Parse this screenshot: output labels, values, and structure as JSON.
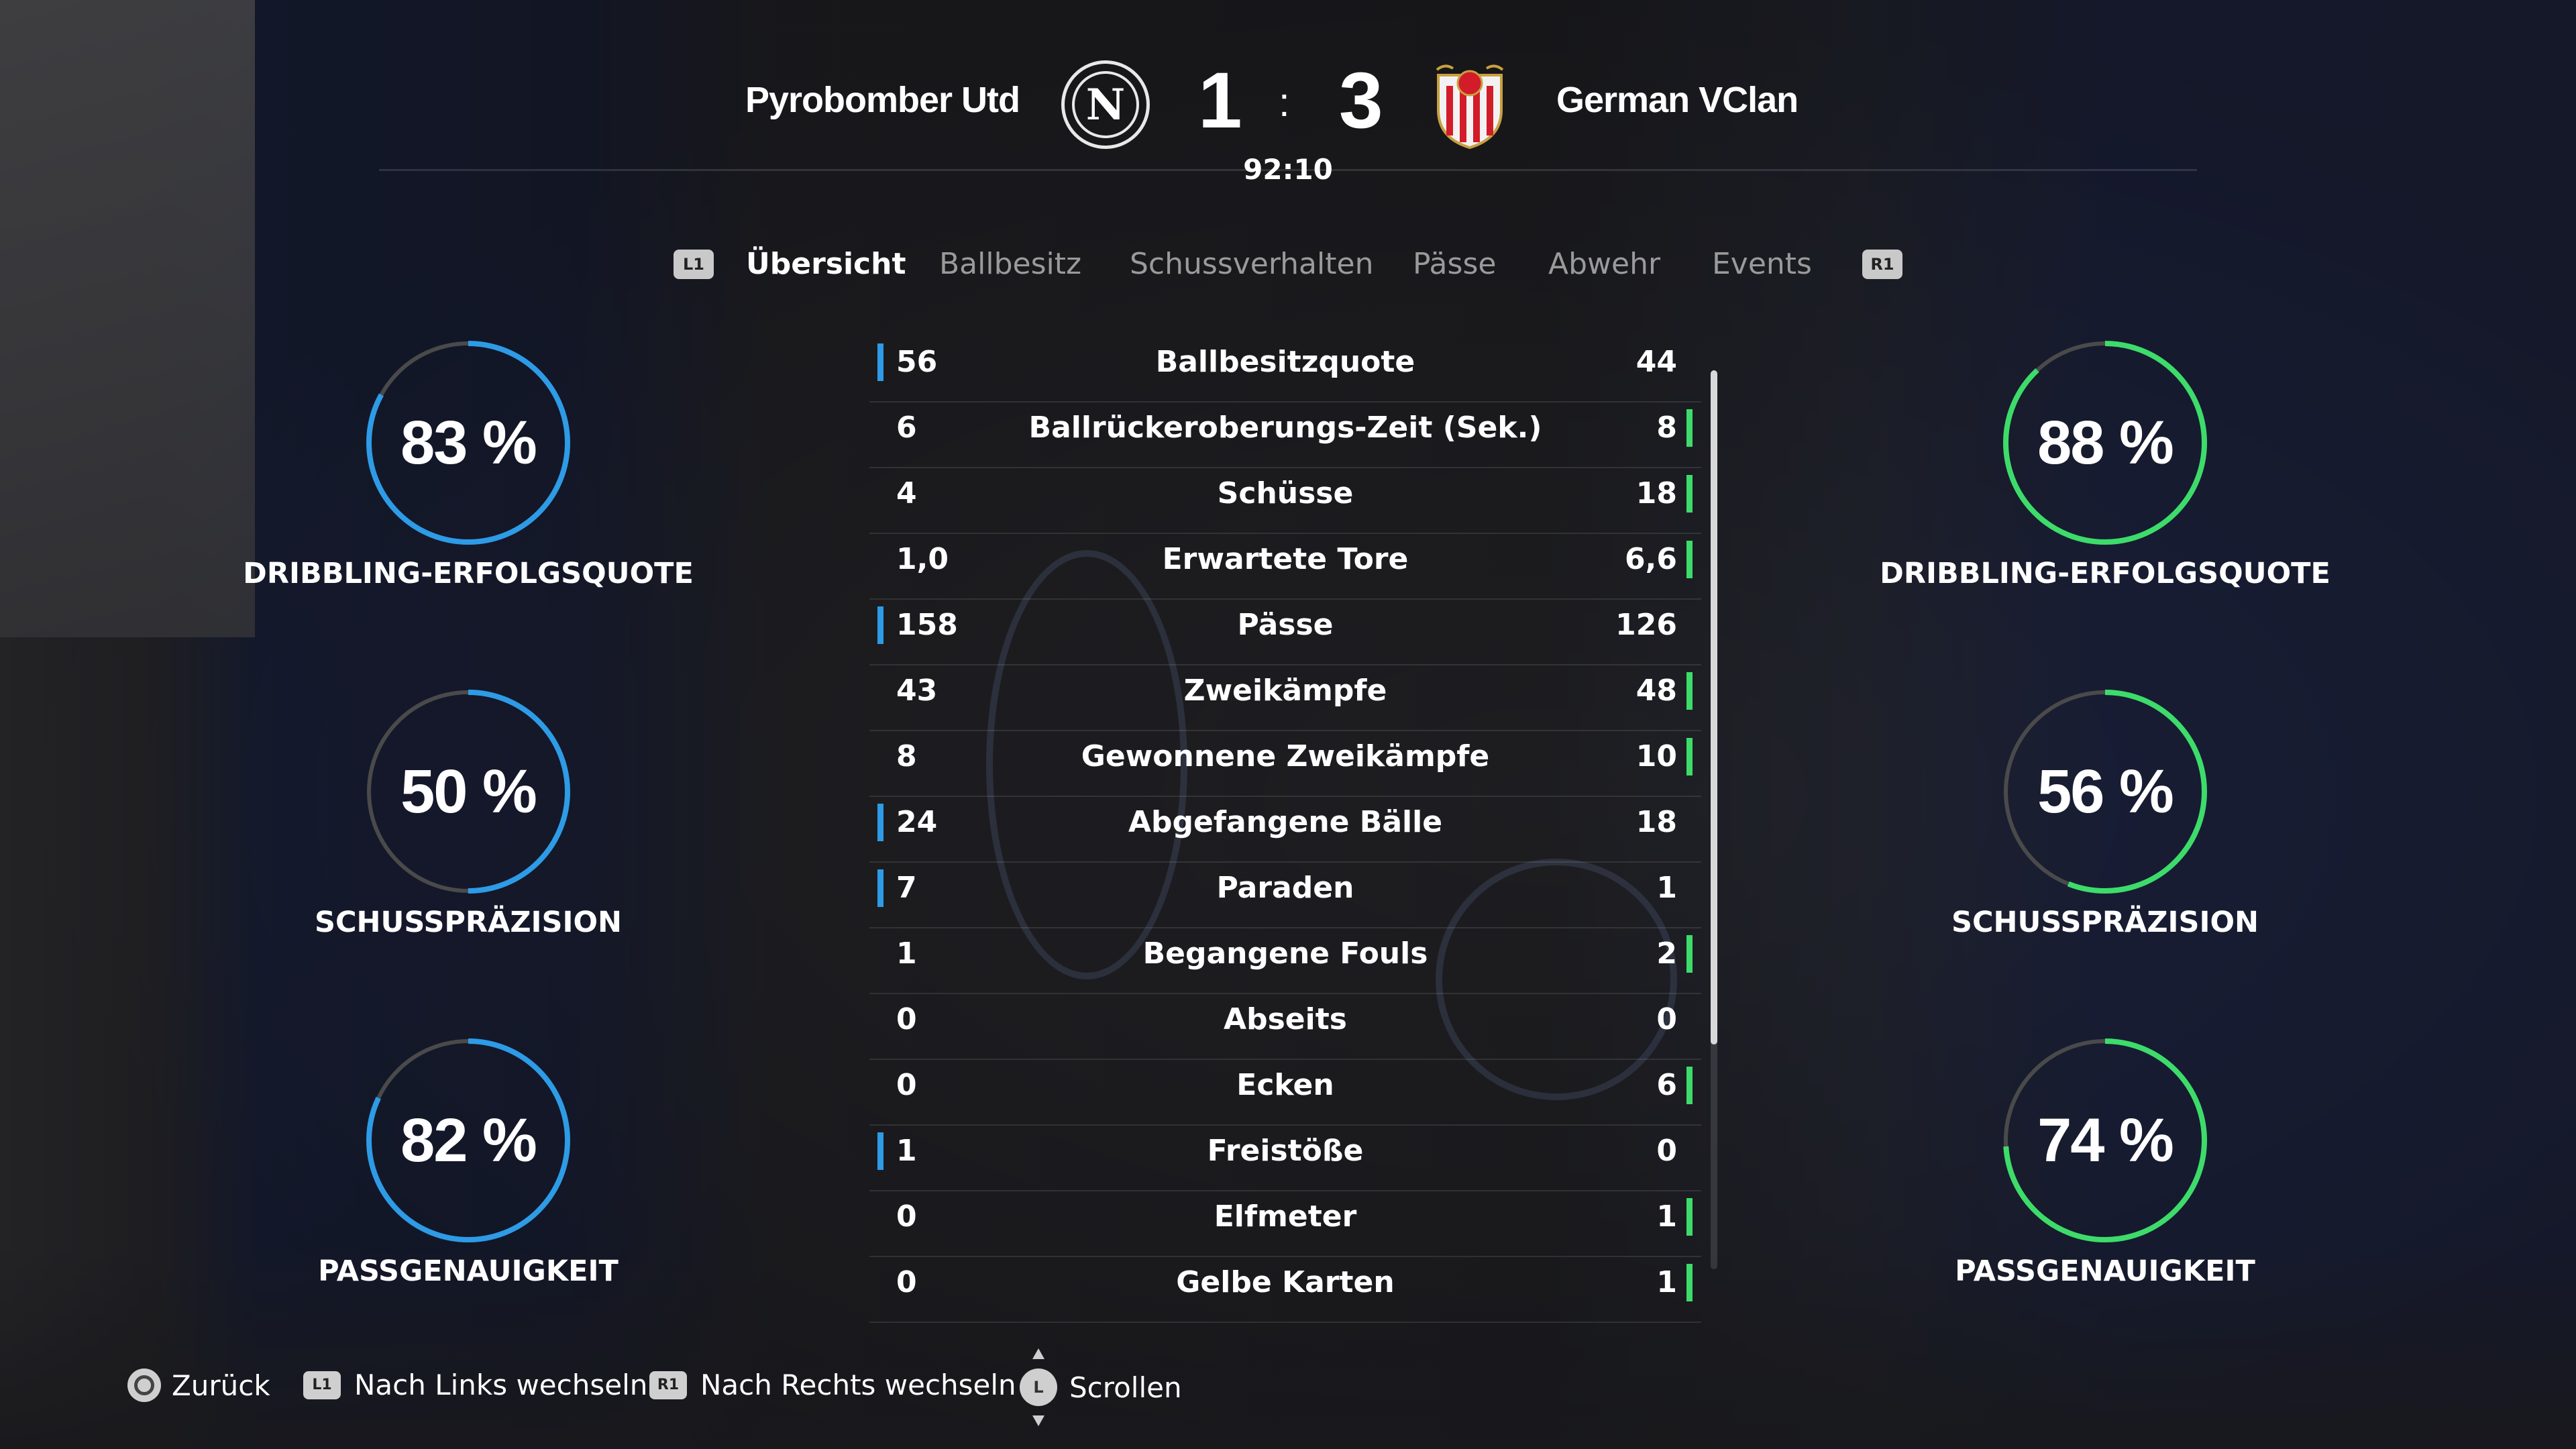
{
  "match": {
    "home_team": "Pyrobomber Utd",
    "away_team": "German VClan",
    "home_score": "1",
    "away_score": "3",
    "separator": ":",
    "clock": "92:10",
    "home_crest_letter": "N"
  },
  "tabs": {
    "left_button": "L1",
    "right_button": "R1",
    "items": [
      "Übersicht",
      "Ballbesitz",
      "Schussverhalten",
      "Pässe",
      "Abwehr",
      "Events"
    ],
    "active": "Übersicht"
  },
  "home_rings": [
    {
      "value": 83,
      "text": "83 %",
      "label": "DRIBBLING-ERFOLGSQUOTE"
    },
    {
      "value": 50,
      "text": "50 %",
      "label": "SCHUSSPRÄZISION"
    },
    {
      "value": 82,
      "text": "82 %",
      "label": "PASSGENAUIGKEIT"
    }
  ],
  "away_rings": [
    {
      "value": 88,
      "text": "88 %",
      "label": "DRIBBLING-ERFOLGSQUOTE"
    },
    {
      "value": 56,
      "text": "56 %",
      "label": "SCHUSSPRÄZISION"
    },
    {
      "value": 74,
      "text": "74 %",
      "label": "PASSGENAUIGKEIT"
    }
  ],
  "stats": [
    {
      "home": "56",
      "label": "Ballbesitzquote",
      "away": "44",
      "leader": "home"
    },
    {
      "home": "6",
      "label": "Ballrückeroberungs-Zeit (Sek.)",
      "away": "8",
      "leader": "away"
    },
    {
      "home": "4",
      "label": "Schüsse",
      "away": "18",
      "leader": "away"
    },
    {
      "home": "1,0",
      "label": "Erwartete Tore",
      "away": "6,6",
      "leader": "away"
    },
    {
      "home": "158",
      "label": "Pässe",
      "away": "126",
      "leader": "home"
    },
    {
      "home": "43",
      "label": "Zweikämpfe",
      "away": "48",
      "leader": "away"
    },
    {
      "home": "8",
      "label": "Gewonnene Zweikämpfe",
      "away": "10",
      "leader": "away"
    },
    {
      "home": "24",
      "label": "Abgefangene Bälle",
      "away": "18",
      "leader": "home"
    },
    {
      "home": "7",
      "label": "Paraden",
      "away": "1",
      "leader": "home"
    },
    {
      "home": "1",
      "label": "Begangene Fouls",
      "away": "2",
      "leader": "away"
    },
    {
      "home": "0",
      "label": "Abseits",
      "away": "0",
      "leader": "none"
    },
    {
      "home": "0",
      "label": "Ecken",
      "away": "6",
      "leader": "away"
    },
    {
      "home": "1",
      "label": "Freistöße",
      "away": "0",
      "leader": "home"
    },
    {
      "home": "0",
      "label": "Elfmeter",
      "away": "1",
      "leader": "away"
    },
    {
      "home": "0",
      "label": "Gelbe Karten",
      "away": "1",
      "leader": "away"
    }
  ],
  "footer": {
    "back": "Zurück",
    "left_button": "L1",
    "left": "Nach Links wechseln",
    "right_button": "R1",
    "right": "Nach Rechts wechseln",
    "stick": "L",
    "scroll": "Scrollen"
  },
  "colors": {
    "home_accent": "#2e9be6",
    "away_accent": "#3ddc6a",
    "ring_track": "#4a4a4a"
  }
}
